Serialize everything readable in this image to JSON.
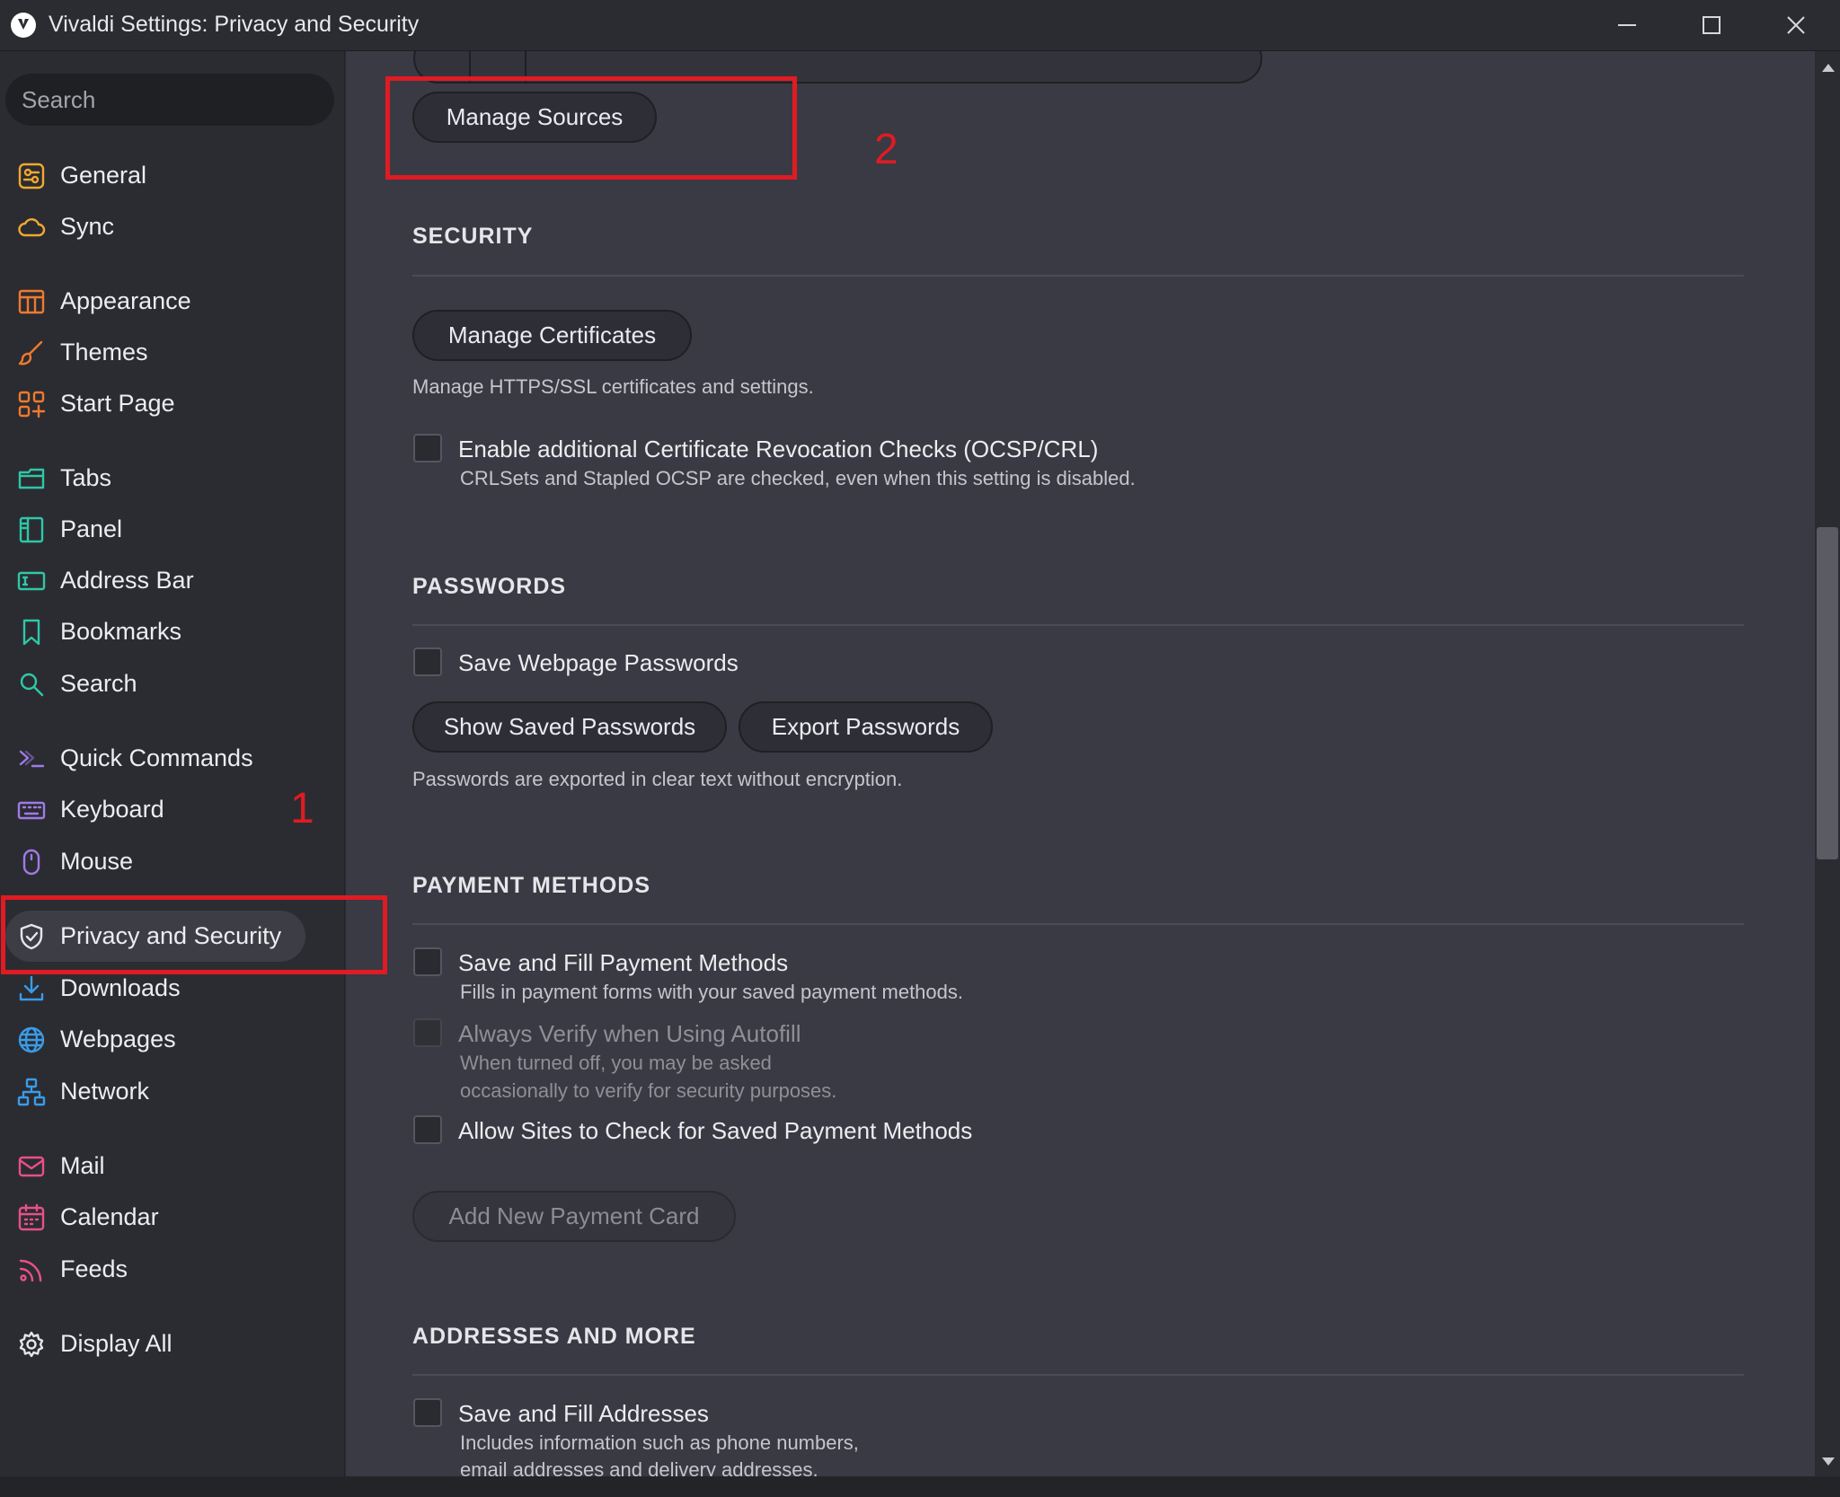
{
  "window": {
    "title": "Vivaldi Settings: Privacy and Security"
  },
  "sidebar": {
    "search_placeholder": "Search",
    "items": [
      {
        "label": "General",
        "icon": "general-icon",
        "color": "#f0a830"
      },
      {
        "label": "Sync",
        "icon": "cloud-icon",
        "color": "#f0a830"
      },
      {
        "label": "Appearance",
        "icon": "appearance-icon",
        "color": "#ef7a2f"
      },
      {
        "label": "Themes",
        "icon": "brush-icon",
        "color": "#ef7a2f"
      },
      {
        "label": "Start Page",
        "icon": "start-page-icon",
        "color": "#ef7a2f"
      },
      {
        "label": "Tabs",
        "icon": "tabs-icon",
        "color": "#2fc7a8"
      },
      {
        "label": "Panel",
        "icon": "panel-icon",
        "color": "#2fc7a8"
      },
      {
        "label": "Address Bar",
        "icon": "address-bar-icon",
        "color": "#2fc7a8"
      },
      {
        "label": "Bookmarks",
        "icon": "bookmark-icon",
        "color": "#2fc7a8"
      },
      {
        "label": "Search",
        "icon": "search-icon",
        "color": "#2fc7a8"
      },
      {
        "label": "Quick Commands",
        "icon": "quick-commands-icon",
        "color": "#a07ae8"
      },
      {
        "label": "Keyboard",
        "icon": "keyboard-icon",
        "color": "#a07ae8"
      },
      {
        "label": "Mouse",
        "icon": "mouse-icon",
        "color": "#a07ae8"
      },
      {
        "label": "Privacy and Security",
        "icon": "shield-icon",
        "color": "#e6e6ea",
        "active": true
      },
      {
        "label": "Downloads",
        "icon": "download-icon",
        "color": "#3a9be8"
      },
      {
        "label": "Webpages",
        "icon": "globe-icon",
        "color": "#3a9be8"
      },
      {
        "label": "Network",
        "icon": "network-icon",
        "color": "#3a9be8"
      },
      {
        "label": "Mail",
        "icon": "mail-icon",
        "color": "#e8508a"
      },
      {
        "label": "Calendar",
        "icon": "calendar-icon",
        "color": "#e8508a"
      },
      {
        "label": "Feeds",
        "icon": "feed-icon",
        "color": "#e8508a"
      },
      {
        "label": "Display All",
        "icon": "gear-icon",
        "color": "#e6e6ea"
      }
    ]
  },
  "main": {
    "manage_sources_label": "Manage Sources",
    "security": {
      "heading": "SECURITY",
      "manage_certificates_label": "Manage Certificates",
      "manage_certificates_desc": "Manage HTTPS/SSL certificates and settings.",
      "revocation_label": "Enable additional Certificate Revocation Checks (OCSP/CRL)",
      "revocation_desc": "CRLSets and Stapled OCSP are checked, even when this setting is disabled."
    },
    "passwords": {
      "heading": "PASSWORDS",
      "save_label": "Save Webpage Passwords",
      "show_saved_label": "Show Saved Passwords",
      "export_label": "Export Passwords",
      "export_desc": "Passwords are exported in clear text without encryption."
    },
    "payment": {
      "heading": "PAYMENT METHODS",
      "save_fill_label": "Save and Fill Payment Methods",
      "save_fill_desc": "Fills in payment forms with your saved payment methods.",
      "verify_label": "Always Verify when Using Autofill",
      "verify_desc_1": "When turned off, you may be asked",
      "verify_desc_2": "occasionally to verify for security purposes.",
      "allow_sites_label": "Allow Sites to Check for Saved Payment Methods",
      "add_card_label": "Add New Payment Card"
    },
    "addresses": {
      "heading": "ADDRESSES AND MORE",
      "save_fill_label": "Save and Fill Addresses",
      "desc_1": "Includes information such as phone numbers,",
      "desc_2": "email addresses and delivery addresses."
    }
  },
  "annotations": {
    "first": "1",
    "second": "2",
    "color": "#e01b23"
  }
}
